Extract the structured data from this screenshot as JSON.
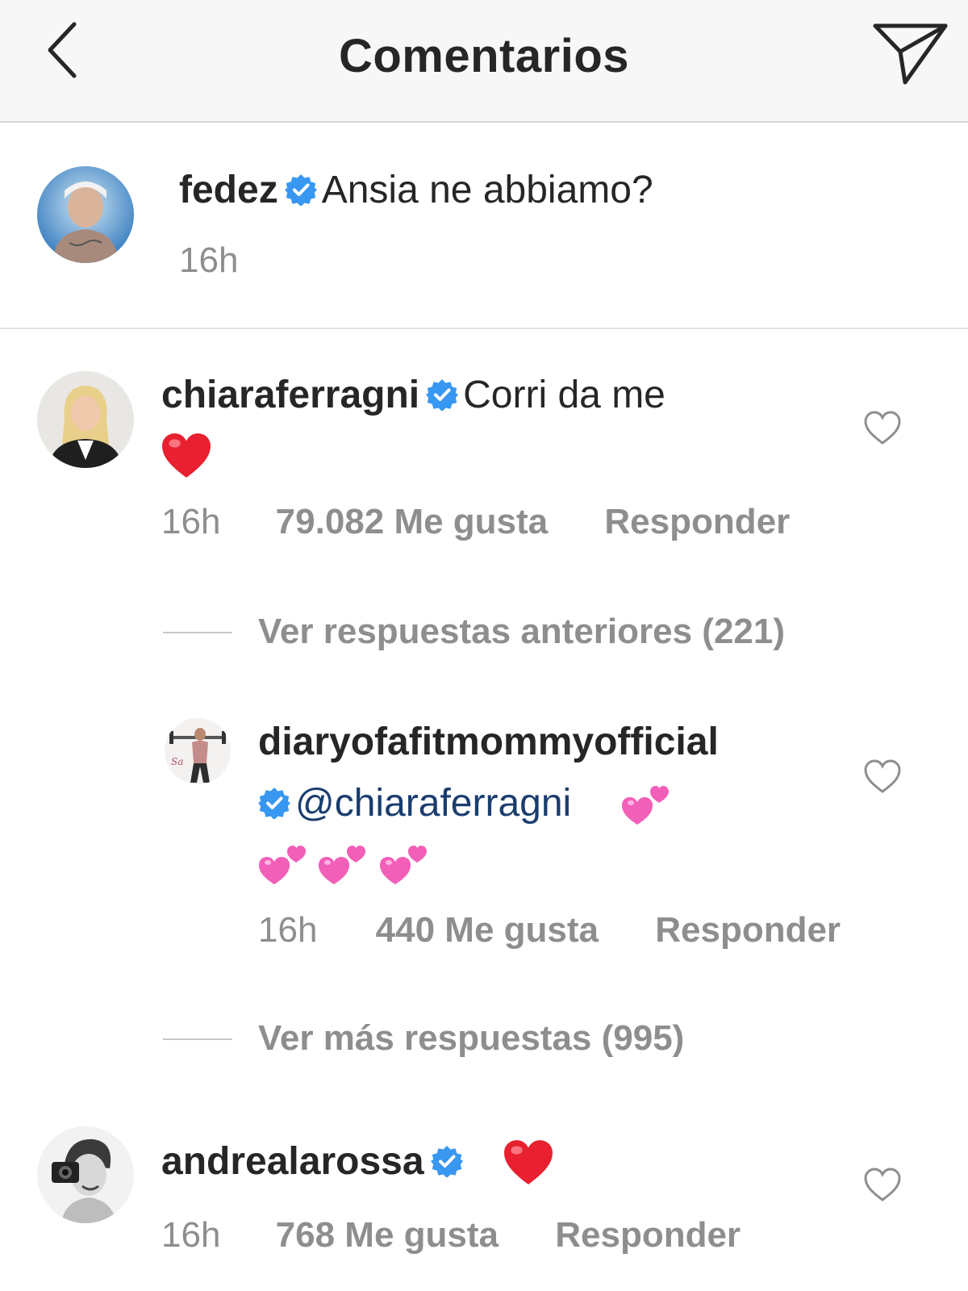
{
  "header": {
    "title": "Comentarios",
    "back_icon": "chevron-left-icon",
    "send_icon": "paper-plane-icon"
  },
  "caption": {
    "username": "fedez",
    "verified": true,
    "text": "Ansia ne abbiamo?",
    "time": "16h"
  },
  "comments": [
    {
      "username": "chiaraferragni",
      "verified": true,
      "text": "Corri da me",
      "emoji": "red-heart",
      "time": "16h",
      "likes": "79.082 Me gusta",
      "reply": "Responder"
    },
    {
      "username": "andrealarossa",
      "verified": true,
      "emoji": "red-heart",
      "time": "16h",
      "likes": "768 Me gusta",
      "reply": "Responder"
    }
  ],
  "thread": {
    "previous_replies": "Ver respuestas anteriores (221)",
    "more_replies": "Ver más respuestas (995)",
    "reply": {
      "username": "diaryofafitmommyofficial",
      "verified": true,
      "mention": "@chiaraferragni",
      "emoji": "two-hearts x4",
      "time": "16h",
      "likes": "440 Me gusta",
      "reply": "Responder"
    }
  },
  "colors": {
    "verified_blue": "#3897f0",
    "meta_gray": "#8e8e8e",
    "text": "#262626",
    "mention": "#1a3d6e",
    "heart_red": "#e8202f",
    "pink_heart": "#f25fb8"
  }
}
